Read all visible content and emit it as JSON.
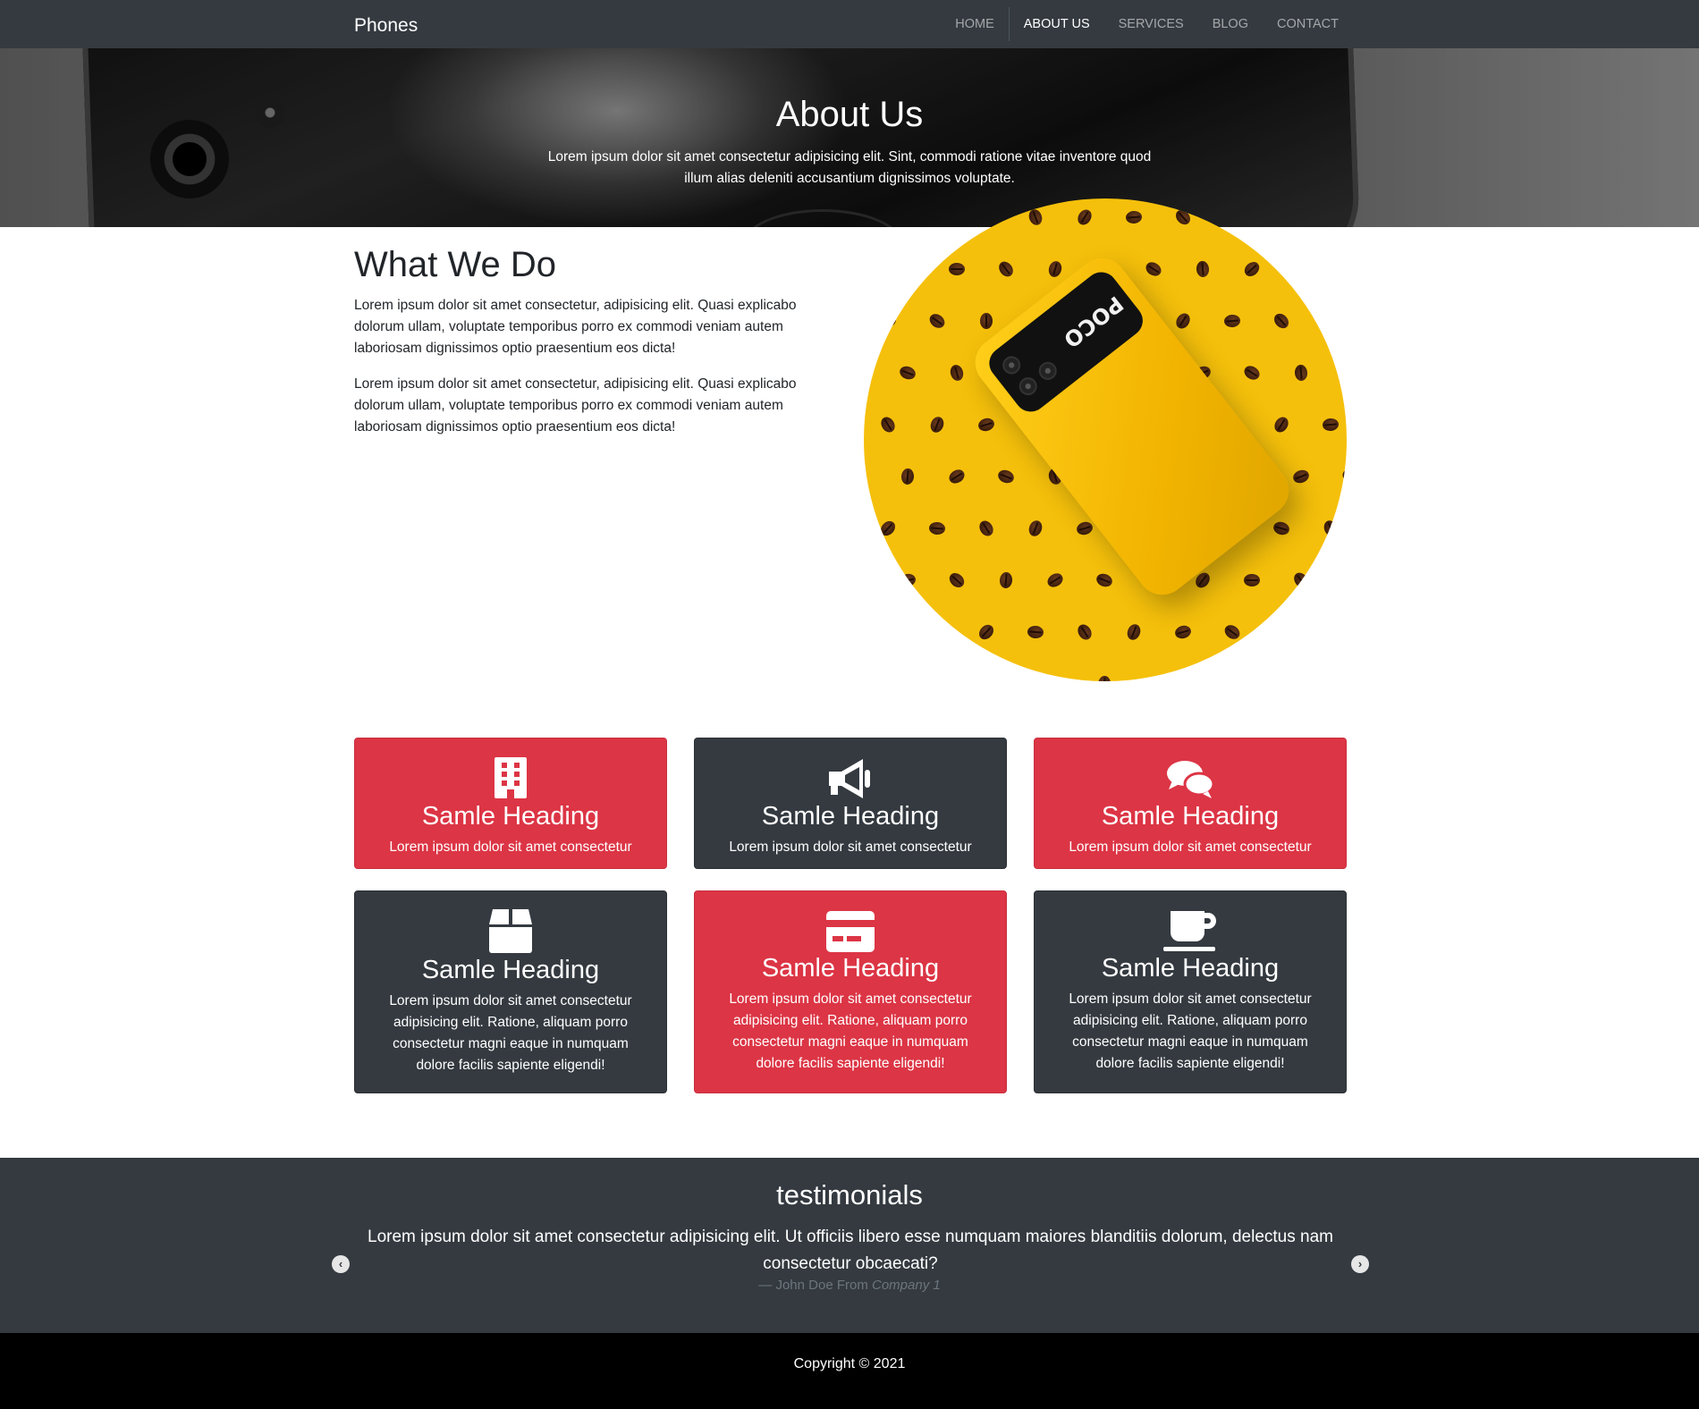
{
  "nav": {
    "brand": "Phones",
    "links": [
      "HOME",
      "ABOUT US",
      "SERVICES",
      "BLOG",
      "CONTACT"
    ]
  },
  "hero": {
    "title": "About Us",
    "text": "Lorem ipsum dolor sit amet consectetur adipisicing elit. Sint, commodi ratione vitae inventore quod illum alias deleniti accusantium dignissimos voluptate."
  },
  "about": {
    "title": "What We Do",
    "paragraphs": [
      "Lorem ipsum dolor sit amet consectetur, adipisicing elit. Quasi explicabo dolorum ullam, voluptate temporibus porro ex commodi veniam autem laboriosam dignissimos optio praesentium eos dicta!",
      "Lorem ipsum dolor sit amet consectetur, adipisicing elit. Quasi explicabo dolorum ullam, voluptate temporibus porro ex commodi veniam autem laboriosam dignissimos optio praesentium eos dicta!"
    ],
    "image_text": "POCO"
  },
  "cards": [
    {
      "icon": "building-icon",
      "heading": "Samle Heading",
      "text": "Lorem ipsum dolor sit amet consectetur",
      "color": "#dc3545"
    },
    {
      "icon": "megaphone-icon",
      "heading": "Samle Heading",
      "text": "Lorem ipsum dolor sit amet consectetur",
      "color": "#343a40"
    },
    {
      "icon": "comments-icon",
      "heading": "Samle Heading",
      "text": "Lorem ipsum dolor sit amet consectetur",
      "color": "#dc3545"
    },
    {
      "icon": "box-icon",
      "heading": "Samle Heading",
      "text": "Lorem ipsum dolor sit amet consectetur adipisicing elit. Ratione, aliquam porro consectetur magni eaque in numquam dolore facilis sapiente eligendi!",
      "color": "#343a40"
    },
    {
      "icon": "credit-card-icon",
      "heading": "Samle Heading",
      "text": "Lorem ipsum dolor sit amet consectetur adipisicing elit. Ratione, aliquam porro consectetur magni eaque in numquam dolore facilis sapiente eligendi!",
      "color": "#dc3545"
    },
    {
      "icon": "coffee-icon",
      "heading": "Samle Heading",
      "text": "Lorem ipsum dolor sit amet consectetur adipisicing elit. Ratione, aliquam porro consectetur magni eaque in numquam dolore facilis sapiente eligendi!",
      "color": "#343a40"
    }
  ],
  "testimonials": {
    "title": "testimonials",
    "quote": "Lorem ipsum dolor sit amet consectetur adipisicing elit. Ut officiis libero esse numquam maiores blanditiis dolorum, delectus nam consectetur obcaecati?",
    "cite_prefix": "— John Doe From",
    "cite_company": "Company 1",
    "prev_icon": "chevron-left-icon",
    "next_icon": "chevron-right-icon"
  },
  "footer": {
    "copyright": "Copyright © 2021"
  }
}
